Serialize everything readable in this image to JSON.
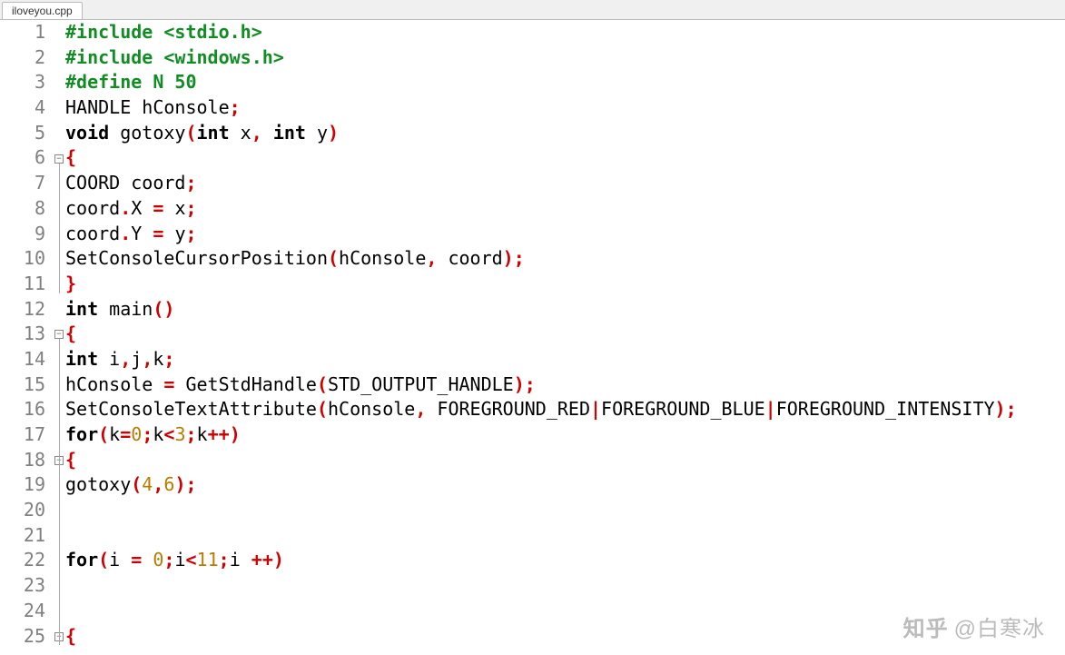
{
  "tab": {
    "filename": "iloveyou.cpp"
  },
  "watermark": {
    "logo": "知乎",
    "author": "@白寒冰"
  },
  "lines": [
    {
      "n": "1",
      "tokens": [
        {
          "t": "#include ",
          "c": "k-preproc"
        },
        {
          "t": "<stdio.h>",
          "c": "k-preproc"
        }
      ]
    },
    {
      "n": "2",
      "tokens": [
        {
          "t": "#include ",
          "c": "k-preproc"
        },
        {
          "t": "<windows.h>",
          "c": "k-preproc"
        }
      ]
    },
    {
      "n": "3",
      "tokens": [
        {
          "t": "#define N 50",
          "c": "k-preproc"
        }
      ]
    },
    {
      "n": "4",
      "tokens": [
        {
          "t": "HANDLE hConsole",
          "c": "k-id"
        },
        {
          "t": ";",
          "c": "k-semi"
        }
      ]
    },
    {
      "n": "5",
      "tokens": [
        {
          "t": "void",
          "c": "k-kw"
        },
        {
          "t": " gotoxy",
          "c": "k-id"
        },
        {
          "t": "(",
          "c": "k-paren"
        },
        {
          "t": "int",
          "c": "k-kw"
        },
        {
          "t": " x",
          "c": "k-id"
        },
        {
          "t": ",",
          "c": "k-op"
        },
        {
          "t": " ",
          "c": ""
        },
        {
          "t": "int",
          "c": "k-kw"
        },
        {
          "t": " y",
          "c": "k-id"
        },
        {
          "t": ")",
          "c": "k-paren"
        }
      ]
    },
    {
      "n": "6",
      "fold": "open",
      "tokens": [
        {
          "t": "{",
          "c": "k-paren"
        }
      ]
    },
    {
      "n": "7",
      "tokens": [
        {
          "t": "COORD coord",
          "c": "k-id"
        },
        {
          "t": ";",
          "c": "k-semi"
        }
      ]
    },
    {
      "n": "8",
      "tokens": [
        {
          "t": "coord",
          "c": "k-id"
        },
        {
          "t": ".",
          "c": "k-op"
        },
        {
          "t": "X ",
          "c": "k-id"
        },
        {
          "t": "=",
          "c": "k-op"
        },
        {
          "t": " x",
          "c": "k-id"
        },
        {
          "t": ";",
          "c": "k-semi"
        }
      ]
    },
    {
      "n": "9",
      "tokens": [
        {
          "t": "coord",
          "c": "k-id"
        },
        {
          "t": ".",
          "c": "k-op"
        },
        {
          "t": "Y ",
          "c": "k-id"
        },
        {
          "t": "=",
          "c": "k-op"
        },
        {
          "t": " y",
          "c": "k-id"
        },
        {
          "t": ";",
          "c": "k-semi"
        }
      ]
    },
    {
      "n": "10",
      "tokens": [
        {
          "t": "SetConsoleCursorPosition",
          "c": "k-id"
        },
        {
          "t": "(",
          "c": "k-paren"
        },
        {
          "t": "hConsole",
          "c": "k-id"
        },
        {
          "t": ",",
          "c": "k-op"
        },
        {
          "t": " coord",
          "c": "k-id"
        },
        {
          "t": ")",
          "c": "k-paren"
        },
        {
          "t": ";",
          "c": "k-semi"
        }
      ]
    },
    {
      "n": "11",
      "tokens": [
        {
          "t": "}",
          "c": "k-paren"
        }
      ]
    },
    {
      "n": "12",
      "tokens": [
        {
          "t": "int",
          "c": "k-kw"
        },
        {
          "t": " main",
          "c": "k-id"
        },
        {
          "t": "()",
          "c": "k-paren"
        }
      ]
    },
    {
      "n": "13",
      "fold": "open",
      "tokens": [
        {
          "t": "{",
          "c": "k-paren"
        }
      ]
    },
    {
      "n": "14",
      "tokens": [
        {
          "t": "int",
          "c": "k-kw"
        },
        {
          "t": " i",
          "c": "k-id"
        },
        {
          "t": ",",
          "c": "k-op"
        },
        {
          "t": "j",
          "c": "k-id"
        },
        {
          "t": ",",
          "c": "k-op"
        },
        {
          "t": "k",
          "c": "k-id"
        },
        {
          "t": ";",
          "c": "k-semi"
        }
      ]
    },
    {
      "n": "15",
      "tokens": [
        {
          "t": "hConsole ",
          "c": "k-id"
        },
        {
          "t": "=",
          "c": "k-op"
        },
        {
          "t": " GetStdHandle",
          "c": "k-id"
        },
        {
          "t": "(",
          "c": "k-paren"
        },
        {
          "t": "STD_OUTPUT_HANDLE",
          "c": "k-id"
        },
        {
          "t": ")",
          "c": "k-paren"
        },
        {
          "t": ";",
          "c": "k-semi"
        }
      ]
    },
    {
      "n": "16",
      "tokens": [
        {
          "t": "SetConsoleTextAttribute",
          "c": "k-id"
        },
        {
          "t": "(",
          "c": "k-paren"
        },
        {
          "t": "hConsole",
          "c": "k-id"
        },
        {
          "t": ",",
          "c": "k-op"
        },
        {
          "t": " FOREGROUND_RED",
          "c": "k-id"
        },
        {
          "t": "|",
          "c": "k-op"
        },
        {
          "t": "FOREGROUND_BLUE",
          "c": "k-id"
        },
        {
          "t": "|",
          "c": "k-op"
        },
        {
          "t": "FOREGROUND_INTENSITY",
          "c": "k-id"
        },
        {
          "t": ")",
          "c": "k-paren"
        },
        {
          "t": ";",
          "c": "k-semi"
        }
      ]
    },
    {
      "n": "17",
      "tokens": [
        {
          "t": "for",
          "c": "k-kw"
        },
        {
          "t": "(",
          "c": "k-paren"
        },
        {
          "t": "k",
          "c": "k-id"
        },
        {
          "t": "=",
          "c": "k-op"
        },
        {
          "t": "0",
          "c": "k-num"
        },
        {
          "t": ";",
          "c": "k-semi"
        },
        {
          "t": "k",
          "c": "k-id"
        },
        {
          "t": "<",
          "c": "k-op"
        },
        {
          "t": "3",
          "c": "k-num"
        },
        {
          "t": ";",
          "c": "k-semi"
        },
        {
          "t": "k",
          "c": "k-id"
        },
        {
          "t": "++",
          "c": "k-op"
        },
        {
          "t": ")",
          "c": "k-paren"
        }
      ]
    },
    {
      "n": "18",
      "fold": "open",
      "tokens": [
        {
          "t": "{",
          "c": "k-paren"
        }
      ]
    },
    {
      "n": "19",
      "tokens": [
        {
          "t": "gotoxy",
          "c": "k-id"
        },
        {
          "t": "(",
          "c": "k-paren"
        },
        {
          "t": "4",
          "c": "k-num"
        },
        {
          "t": ",",
          "c": "k-op"
        },
        {
          "t": "6",
          "c": "k-num"
        },
        {
          "t": ")",
          "c": "k-paren"
        },
        {
          "t": ";",
          "c": "k-semi"
        }
      ]
    },
    {
      "n": "20",
      "tokens": []
    },
    {
      "n": "21",
      "tokens": []
    },
    {
      "n": "22",
      "tokens": [
        {
          "t": "for",
          "c": "k-kw"
        },
        {
          "t": "(",
          "c": "k-paren"
        },
        {
          "t": "i ",
          "c": "k-id"
        },
        {
          "t": "=",
          "c": "k-op"
        },
        {
          "t": " ",
          "c": ""
        },
        {
          "t": "0",
          "c": "k-num"
        },
        {
          "t": ";",
          "c": "k-semi"
        },
        {
          "t": "i",
          "c": "k-id"
        },
        {
          "t": "<",
          "c": "k-op"
        },
        {
          "t": "11",
          "c": "k-num"
        },
        {
          "t": ";",
          "c": "k-semi"
        },
        {
          "t": "i ",
          "c": "k-id"
        },
        {
          "t": "++",
          "c": "k-op"
        },
        {
          "t": ")",
          "c": "k-paren"
        }
      ]
    },
    {
      "n": "23",
      "tokens": []
    },
    {
      "n": "24",
      "tokens": []
    },
    {
      "n": "25",
      "fold": "open",
      "tokens": [
        {
          "t": "{",
          "c": "k-paren"
        }
      ]
    }
  ],
  "fold_segments": [
    {
      "from": 6,
      "to": 11
    },
    {
      "from": 13,
      "to": 25
    }
  ]
}
